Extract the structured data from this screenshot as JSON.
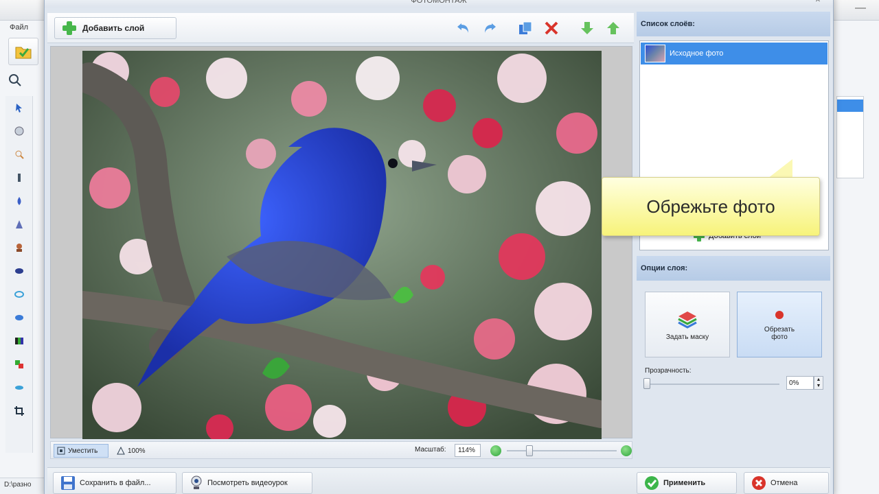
{
  "background_app": {
    "menu_file": "Файл",
    "status_path": "D:\\разно"
  },
  "dialog": {
    "title": "ФОТОМОНТАЖ",
    "toolbar": {
      "add_layer_label": "Добавить слой"
    },
    "statusbar": {
      "fit_label": "Уместить",
      "percent_label": "100%",
      "scale_label": "Масштаб:",
      "scale_value": "114%"
    },
    "bottom": {
      "save_label": "Сохранить в файл...",
      "video_label": "Посмотреть видеоурок",
      "apply_label": "Применить",
      "cancel_label": "Отмена"
    },
    "right_panel": {
      "layers_header": "Список слоёв:",
      "layers": [
        {
          "name": "Исходное фото",
          "selected": true
        }
      ],
      "add_layer_link": "Добавить слой",
      "options_header": "Опции слоя:",
      "mask_button": "Задать маску",
      "crop_button": "Обрезать фото",
      "transparency_label": "Прозрачность:",
      "transparency_value": "0%"
    },
    "callout_text": "Обрежьте фото"
  },
  "colors": {
    "accent_blue": "#3e8ee8",
    "header_blue": "#b6cbe6",
    "callout_yellow": "#f7f37a",
    "green_icon": "#2da53b",
    "red_icon": "#d9342b"
  }
}
